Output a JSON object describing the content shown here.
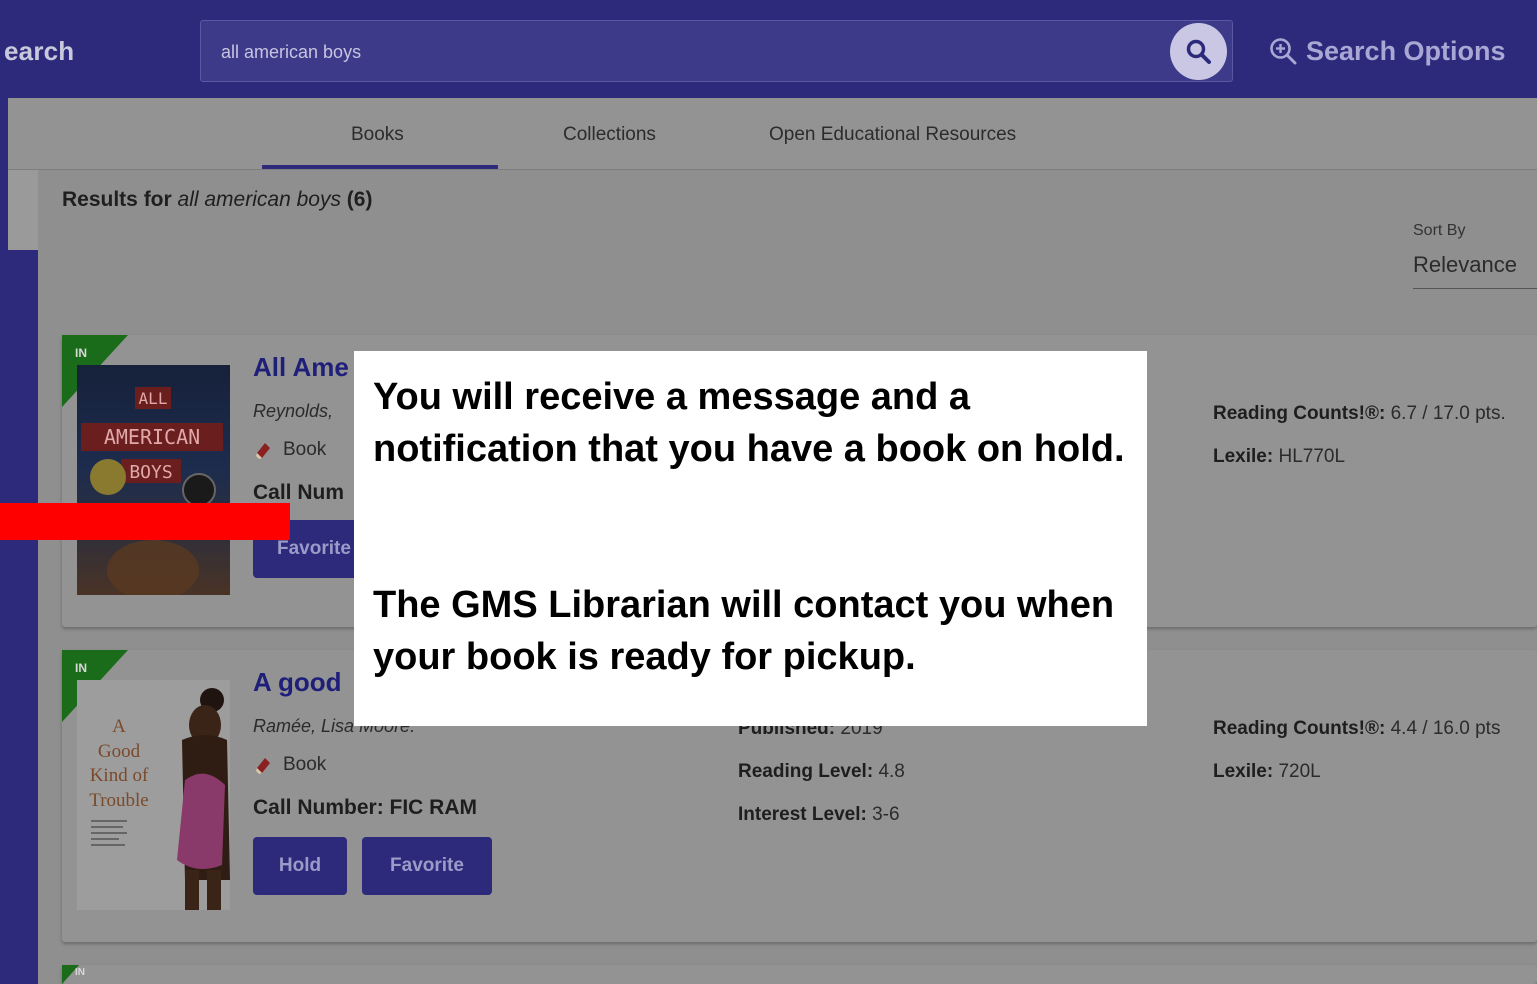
{
  "topbar": {
    "title_fragment": "earch",
    "search_value": "all american boys",
    "search_options_label": "Search Options"
  },
  "tabs": [
    {
      "label": "Books",
      "active": true
    },
    {
      "label": "Collections",
      "active": false
    },
    {
      "label": "Open Educational Resources",
      "active": false
    }
  ],
  "results": {
    "prefix": "Results for ",
    "query": "all american boys",
    "count": "(6)"
  },
  "sort": {
    "label": "Sort By",
    "value": "Relevance"
  },
  "books": [
    {
      "status": "IN",
      "title": "All Ame",
      "author": "Reynolds,",
      "format": "Book",
      "call_number": "Call Num",
      "favorite_label": "Favorite",
      "reading_counts_label": "Reading Counts!®:",
      "reading_counts_value": "6.7 / 17.0 pts.",
      "lexile_label": "Lexile:",
      "lexile_value": "HL770L",
      "cover_texts": [
        "ALL",
        "AMERICAN",
        "BOYS"
      ]
    },
    {
      "status": "IN",
      "title": "A good",
      "author": "Ramée, Lisa Moore.",
      "format": "Book",
      "call_number": "Call Number: FIC RAM",
      "hold_label": "Hold",
      "favorite_label": "Favorite",
      "published_label": "Published:",
      "published_value": "2019",
      "reading_level_label": "Reading Level:",
      "reading_level_value": "4.8",
      "interest_level_label": "Interest Level:",
      "interest_level_value": "3-6",
      "reading_counts_label": "Reading Counts!®:",
      "reading_counts_value": "4.4 / 16.0 pts",
      "lexile_label": "Lexile:",
      "lexile_value": "720L",
      "cover_texts": [
        "A",
        "Good",
        "Kind of",
        "Trouble"
      ]
    },
    {
      "status": "IN"
    }
  ],
  "callout": {
    "line1": "You will receive a message and a notification that you have a book on hold.",
    "line2": "The GMS Librarian will contact you when your book is ready for pickup."
  },
  "colors": {
    "navy": "#2d2a7c",
    "overlay_gray": "#8f8f8f",
    "ribbon_green": "#1a6b1a",
    "marker_red": "#ff0000"
  }
}
